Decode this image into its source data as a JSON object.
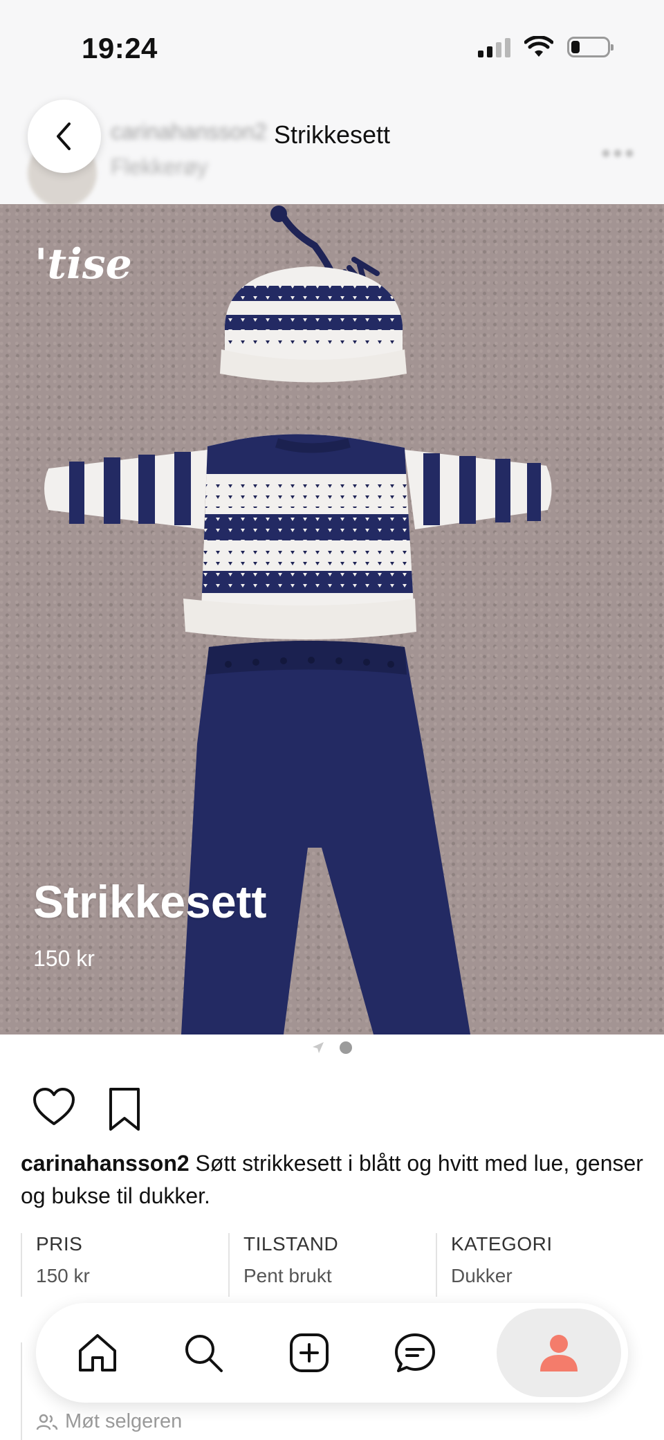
{
  "status_bar": {
    "time": "19:24",
    "icons": [
      "signal-icon",
      "wifi-icon",
      "battery-icon"
    ]
  },
  "header": {
    "title": "Strikkesett",
    "background_username": "carinahansson2",
    "background_location": "Flekkerøy",
    "back_icon": "chevron-left-icon",
    "more_icon": "more-icon"
  },
  "listing": {
    "logo": "'tise",
    "title": "Strikkesett",
    "price": "150 kr",
    "image_count": 2,
    "current_image": 2
  },
  "actions": {
    "like_icon": "heart-icon",
    "save_icon": "bookmark-icon"
  },
  "description": {
    "username": "carinahansson2",
    "text": " Søtt strikkesett i blått og hvitt med lue, genser og bukse til dukker."
  },
  "info": [
    {
      "label": "PRIS",
      "value": "150 kr"
    },
    {
      "label": "TILSTAND",
      "value": "Pent brukt"
    },
    {
      "label": "KATEGORI",
      "value": "Dukker"
    }
  ],
  "faded_section": {
    "seller_link": "Møt selgeren"
  },
  "bottom_nav": {
    "items": [
      "home-icon",
      "search-icon",
      "add-icon",
      "messages-icon",
      "profile-icon"
    ],
    "active": "profile-icon",
    "active_color": "#f47c6b"
  }
}
